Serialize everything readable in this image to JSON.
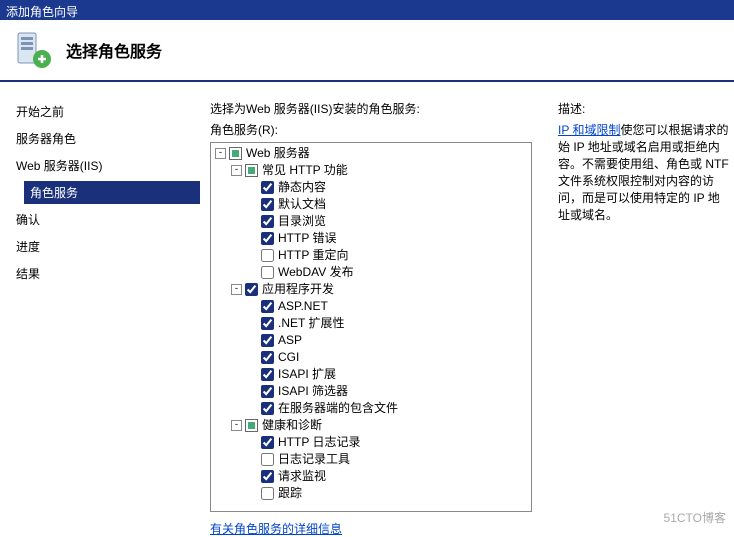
{
  "window": {
    "title": "添加角色向导"
  },
  "header": {
    "title": "选择角色服务"
  },
  "nav": {
    "items": [
      {
        "label": "开始之前"
      },
      {
        "label": "服务器角色"
      },
      {
        "label": "Web 服务器(IIS)"
      },
      {
        "label": "角色服务"
      },
      {
        "label": "确认"
      },
      {
        "label": "进度"
      },
      {
        "label": "结果"
      }
    ]
  },
  "main": {
    "instruction": "选择为Web 服务器(IIS)安装的角色服务:",
    "list_label": "角色服务(R):",
    "more_link": "有关角色服务的详细信息"
  },
  "tree": [
    {
      "depth": 0,
      "expand": "-",
      "check": "partial",
      "label": "Web 服务器"
    },
    {
      "depth": 1,
      "expand": "-",
      "check": "partial",
      "label": "常见 HTTP 功能"
    },
    {
      "depth": 2,
      "expand": "",
      "check": "on",
      "label": "静态内容"
    },
    {
      "depth": 2,
      "expand": "",
      "check": "on",
      "label": "默认文档"
    },
    {
      "depth": 2,
      "expand": "",
      "check": "on",
      "label": "目录浏览"
    },
    {
      "depth": 2,
      "expand": "",
      "check": "on",
      "label": "HTTP 错误"
    },
    {
      "depth": 2,
      "expand": "",
      "check": "off",
      "label": "HTTP 重定向"
    },
    {
      "depth": 2,
      "expand": "",
      "check": "off",
      "label": "WebDAV 发布"
    },
    {
      "depth": 1,
      "expand": "-",
      "check": "on",
      "label": "应用程序开发"
    },
    {
      "depth": 2,
      "expand": "",
      "check": "on",
      "label": "ASP.NET"
    },
    {
      "depth": 2,
      "expand": "",
      "check": "on",
      "label": ".NET 扩展性"
    },
    {
      "depth": 2,
      "expand": "",
      "check": "on",
      "label": "ASP"
    },
    {
      "depth": 2,
      "expand": "",
      "check": "on",
      "label": "CGI"
    },
    {
      "depth": 2,
      "expand": "",
      "check": "on",
      "label": "ISAPI 扩展"
    },
    {
      "depth": 2,
      "expand": "",
      "check": "on",
      "label": "ISAPI 筛选器"
    },
    {
      "depth": 2,
      "expand": "",
      "check": "on",
      "label": "在服务器端的包含文件"
    },
    {
      "depth": 1,
      "expand": "-",
      "check": "partial",
      "label": "健康和诊断"
    },
    {
      "depth": 2,
      "expand": "",
      "check": "on",
      "label": "HTTP 日志记录"
    },
    {
      "depth": 2,
      "expand": "",
      "check": "off",
      "label": "日志记录工具"
    },
    {
      "depth": 2,
      "expand": "",
      "check": "on",
      "label": "请求监视"
    },
    {
      "depth": 2,
      "expand": "",
      "check": "off",
      "label": "跟踪"
    }
  ],
  "desc": {
    "title": "描述:",
    "link_text": "IP 和域限制",
    "body": "使您可以根据请求的始 IP 地址或域名启用或拒绝内容。不需要使用组、角色或 NTF文件系统权限控制对内容的访问，而是可以使用特定的 IP 地址或域名。"
  },
  "watermark": "51CTO博客"
}
